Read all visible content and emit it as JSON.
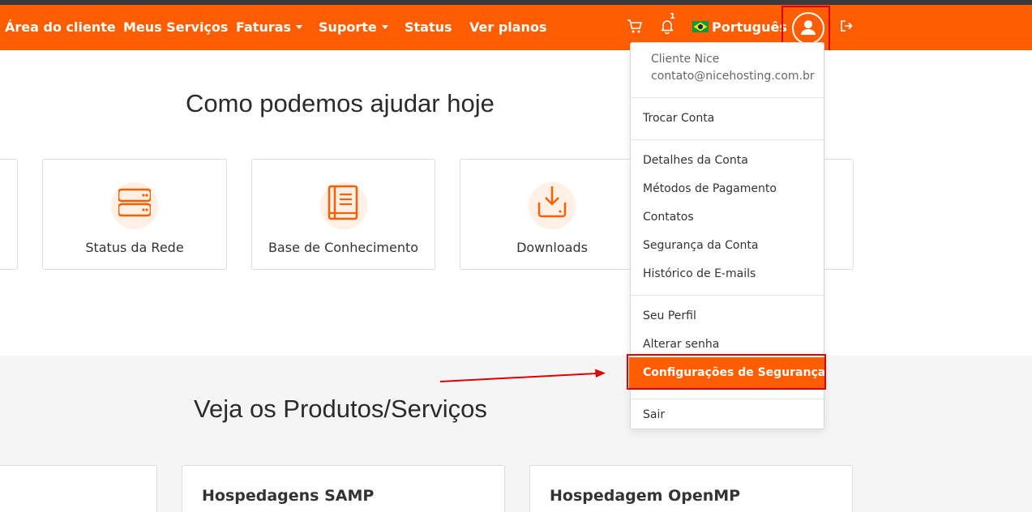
{
  "nav": {
    "items": [
      "Área do cliente",
      "Meus Serviços",
      "Faturas",
      "Suporte",
      "Status",
      "Ver planos"
    ],
    "notification_count": "1",
    "language": "Português"
  },
  "main": {
    "heading": "Como podemos ajudar hoje",
    "cards": [
      "Status da Rede",
      "Base de Conhecimento",
      "Downloads"
    ]
  },
  "products": {
    "heading": "Veja os Produtos/Serviços",
    "cards": [
      "Hospedagens SAMP",
      "Hospedagem OpenMP"
    ]
  },
  "dropdown": {
    "user_name": "Cliente Nice",
    "user_email": "contato@nicehosting.com.br",
    "items": [
      "Trocar Conta",
      "Detalhes da Conta",
      "Métodos de Pagamento",
      "Contatos",
      "Segurança da Conta",
      "Histórico de E-mails",
      "Seu Perfil",
      "Alterar senha",
      "Configurações de Segurança",
      "Sair"
    ]
  },
  "colors": {
    "brand": "#ff5d00",
    "annotation": "#e00000"
  },
  "icons": [
    "cart-icon",
    "bell-icon",
    "brazil-flag-icon",
    "user-icon",
    "logout-icon",
    "server-icon",
    "book-icon",
    "download-icon"
  ]
}
